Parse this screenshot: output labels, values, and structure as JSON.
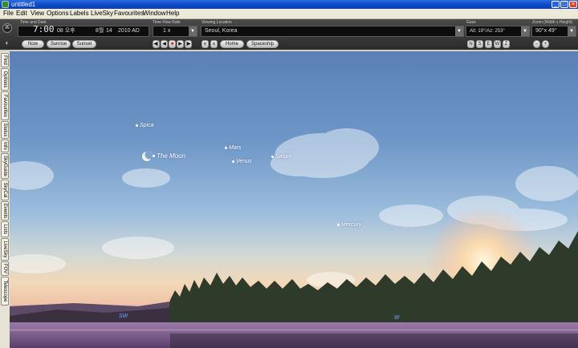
{
  "window": {
    "title": "untitled1"
  },
  "menu": [
    "File",
    "Edit",
    "View",
    "Options",
    "Labels",
    "LiveSky",
    "Favourites",
    "Window",
    "Help"
  ],
  "toolbar": {
    "time_date_label": "Time and Date",
    "time_value": "7:00",
    "ampm": "08 오후",
    "month": "8월",
    "day": "14",
    "year": "2010 AD",
    "time_flow_label": "Time Flow Rate",
    "time_flow_value": "1 x",
    "viewing_location_label": "Viewing Location",
    "location_value": "Seoul, Korea",
    "gaze_label": "Gaze",
    "gaze_value": "Alt: 19°/Az: 253°",
    "zoom_label": "Zoom (Width x Height)",
    "zoom_value": "90°x 49°",
    "buttons": {
      "now": "Now",
      "sunrise": "Sunrise",
      "sunset": "Sunset",
      "home": "Home",
      "spaceship": "Spaceship",
      "n": "N",
      "s": "S",
      "e": "E",
      "w": "W",
      "z": "Z",
      "minus": "−",
      "plus": "+"
    },
    "playback": [
      "◀|",
      "◀",
      "■",
      "▶",
      "|▶"
    ],
    "nav": [
      "∨",
      "∧"
    ]
  },
  "sidetabs": [
    "Find",
    "Options",
    "Favourites",
    "Status",
    "Info",
    "SkyGuide",
    "SkyCal",
    "Events",
    "Lists",
    "LiveSky",
    "FOV",
    "Telescope"
  ],
  "sky_objects": {
    "spica": "Spica",
    "moon": "The Moon",
    "mars": "Mars",
    "venus": "Venus",
    "saturn": "Saturn",
    "mercury": "Mercury"
  },
  "compass": {
    "sw": "SW",
    "w": "W"
  },
  "colors": {
    "accent": "#0a47c7",
    "sky_top": "#5a80b6"
  }
}
